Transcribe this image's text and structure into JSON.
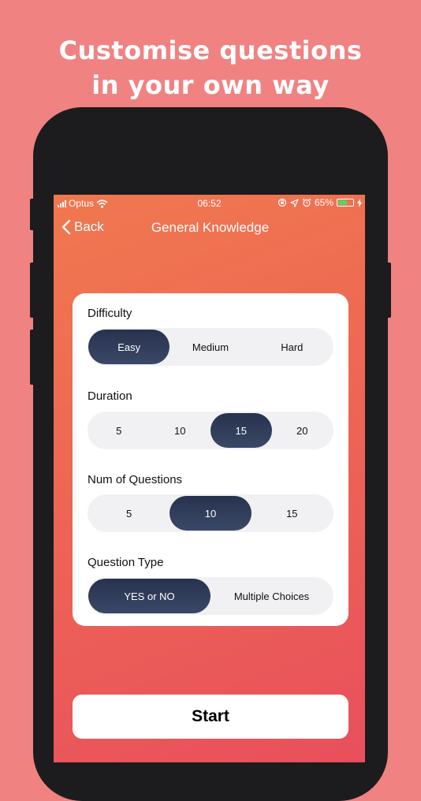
{
  "promo": {
    "headline_line1": "Customise questions",
    "headline_line2": "in your own way"
  },
  "status_bar": {
    "carrier": "Optus",
    "time": "06:52",
    "battery_percent": "65%",
    "battery_level": 0.65
  },
  "nav": {
    "back_label": "Back",
    "title": "General Knowledge"
  },
  "settings": {
    "difficulty": {
      "label": "Difficulty",
      "options": [
        "Easy",
        "Medium",
        "Hard"
      ],
      "selected": "Easy"
    },
    "duration": {
      "label": "Duration",
      "options": [
        "5",
        "10",
        "15",
        "20"
      ],
      "selected": "15"
    },
    "num_questions": {
      "label": "Num of Questions",
      "options": [
        "5",
        "10",
        "15"
      ],
      "selected": "10"
    },
    "question_type": {
      "label": "Question Type",
      "options": [
        "YES or NO",
        "Multiple Choices"
      ],
      "selected": "YES or NO"
    }
  },
  "start_label": "Start",
  "colors": {
    "background": "#f08282",
    "screen_gradient_top": "#f0784f",
    "screen_gradient_bottom": "#e8505c",
    "selected_segment": "#2d3a58",
    "segment_track": "#f1f1f3",
    "battery_green": "#4cd964"
  }
}
